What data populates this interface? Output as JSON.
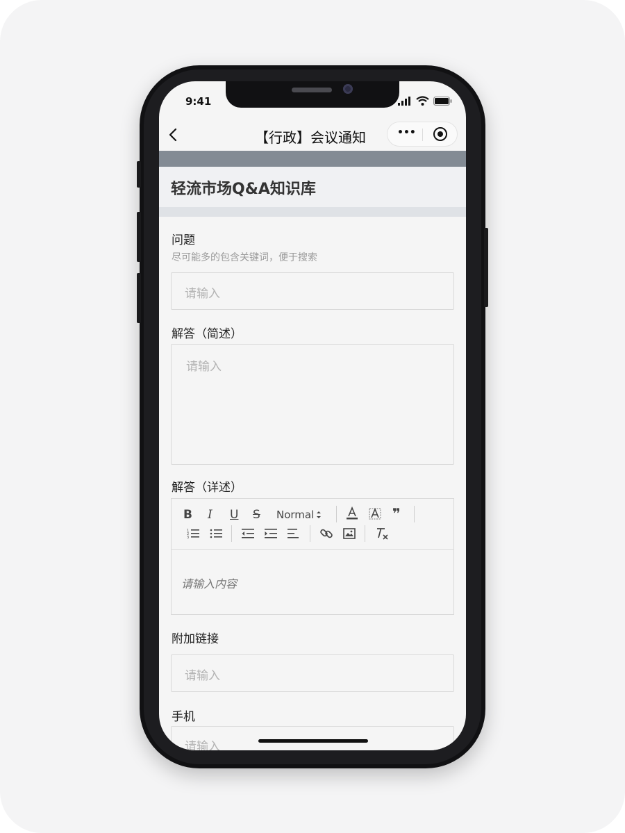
{
  "status_bar": {
    "time": "9:41"
  },
  "nav": {
    "title": "【行政】会议通知",
    "more_label": "•••"
  },
  "banner": {
    "title": "轻流市场Q&A知识库"
  },
  "form": {
    "question": {
      "label": "问题",
      "hint": "尽可能多的包含关键词，便于搜索",
      "placeholder": "请输入"
    },
    "answer_brief": {
      "label": "解答（简述）",
      "placeholder": "请输入"
    },
    "answer_detail": {
      "label": "解答（详述）",
      "placeholder": "请输入内容",
      "toolbar": {
        "bold": "B",
        "italic": "I",
        "underline": "U",
        "strike": "S",
        "format": "Normal",
        "quote": "❞"
      }
    },
    "extra_link": {
      "label": "附加链接",
      "placeholder": "请输入"
    },
    "phone": {
      "label": "手机",
      "placeholder": "请输入"
    }
  },
  "colors": {
    "banner_stripe": "#838b94",
    "text_primary": "#222222",
    "placeholder": "#b3b3b3"
  }
}
